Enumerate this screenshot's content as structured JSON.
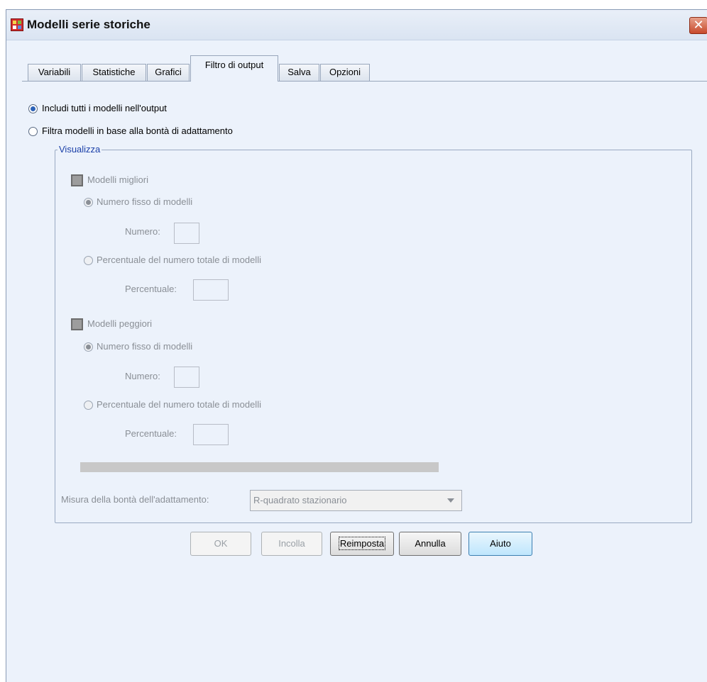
{
  "window": {
    "title": "Modelli serie storiche",
    "close_glyph": "✕"
  },
  "tabs": [
    {
      "label": "Variabili",
      "active": false
    },
    {
      "label": "Statistiche",
      "active": false
    },
    {
      "label": "Grafici",
      "active": false
    },
    {
      "label": "Filtro di output",
      "active": true
    },
    {
      "label": "Salva",
      "active": false
    },
    {
      "label": "Opzioni",
      "active": false
    }
  ],
  "filter": {
    "include_all_label": "Includi tutti i modelli nell'output",
    "filter_by_fit_label": "Filtra modelli in base alla bontà di adattamento",
    "selected": "include_all"
  },
  "display_group": {
    "legend": "Visualizza",
    "best": {
      "checkbox_label": "Modelli migliori",
      "fixed_label": "Numero fisso di modelli",
      "number_label": "Numero:",
      "number_value": "",
      "percent_option_label": "Percentuale del numero totale di modelli",
      "percent_label": "Percentuale:",
      "percent_value": ""
    },
    "worst": {
      "checkbox_label": "Modelli peggiori",
      "fixed_label": "Numero fisso di modelli",
      "number_label": "Numero:",
      "number_value": "",
      "percent_option_label": "Percentuale del numero totale di modelli",
      "percent_label": "Percentuale:",
      "percent_value": ""
    },
    "fit_measure_label": "Misura della bontà dell'adattamento:",
    "fit_measure_value": "R-quadrato stazionario"
  },
  "buttons": {
    "ok": "OK",
    "paste": "Incolla",
    "reset": "Reimposta",
    "cancel": "Annulla",
    "help": "Aiuto"
  }
}
